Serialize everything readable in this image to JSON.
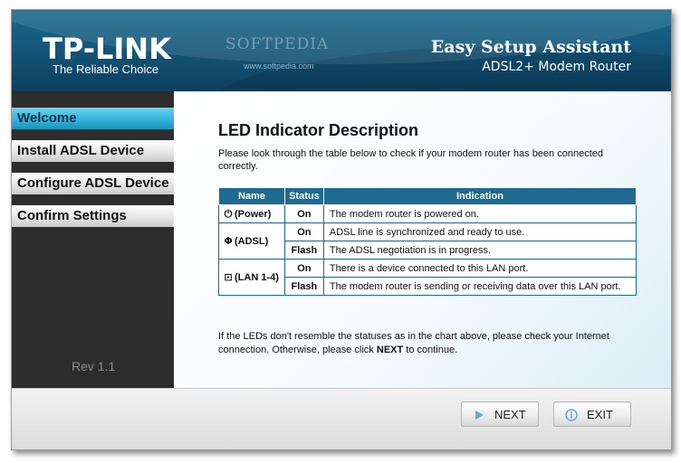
{
  "header": {
    "logo": "TP-LINK",
    "slogan": "The Reliable Choice",
    "watermark": "SOFTPEDIA",
    "watermark_url": "www.softpedia.com",
    "app_title": "Easy Setup Assistant",
    "app_subtitle": "ADSL2+ Modem Router"
  },
  "sidebar": {
    "items": [
      {
        "label": "Welcome",
        "active": true
      },
      {
        "label": "Install ADSL Device",
        "active": false
      },
      {
        "label": "Configure ADSL Device",
        "active": false
      },
      {
        "label": "Confirm Settings",
        "active": false
      }
    ],
    "version": "Rev 1.1"
  },
  "main": {
    "title": "LED Indicator Description",
    "intro": "Please look through the table below to check if your modem router has been connected correctly.",
    "table": {
      "headers": [
        "Name",
        "Status",
        "Indication"
      ],
      "rows": [
        {
          "name": "(Power)",
          "icon": "power-icon",
          "status": "On",
          "indication": "The modem router is powered on."
        },
        {
          "name": "(ADSL)",
          "icon": "adsl-icon",
          "status": "On",
          "indication": "ADSL line is synchronized and ready to use."
        },
        {
          "status": "Flash",
          "indication": "The ADSL negotiation is in progress."
        },
        {
          "name": "(LAN 1-4)",
          "icon": "lan-icon",
          "status": "On",
          "indication": "There is a device connected to this LAN port."
        },
        {
          "status": "Flash",
          "indication": "The modem router is sending or receiving data over this LAN port."
        }
      ]
    },
    "note_before": "If the LEDs don't resemble the statuses as in the chart above, please check your Internet connection. Otherwise, please click ",
    "note_bold": "NEXT",
    "note_after": " to continue."
  },
  "footer": {
    "next_label": "NEXT",
    "exit_label": "EXIT"
  },
  "colors": {
    "header_blue": "#14577a",
    "table_header": "#1e6a90",
    "active_nav": "#2fb0d8",
    "sidebar_bg": "#2d2d2d"
  }
}
